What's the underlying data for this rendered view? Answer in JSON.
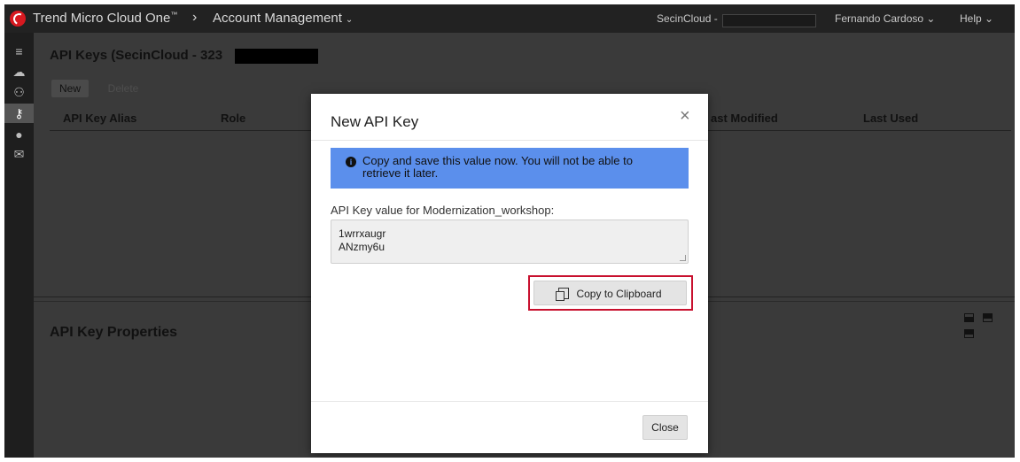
{
  "topbar": {
    "brand": "Trend Micro Cloud One",
    "brand_tm": "™",
    "separator": "›",
    "section": "Account Management",
    "section_chevron": "⌄",
    "account": "SecinCloud -",
    "user": "Fernando Cardoso",
    "user_chevron": "⌄",
    "help": "Help",
    "help_chevron": "⌄"
  },
  "sidebar": {
    "icons": [
      "menu-icon",
      "cloud-icon",
      "users-icon",
      "key-icon",
      "user-icon",
      "mail-icon"
    ],
    "active": "key-icon"
  },
  "main": {
    "title": "API Keys (SecinCloud - 323",
    "new_label": "New",
    "delete_label": "Delete",
    "columns": [
      "API Key Alias",
      "Role",
      "ast Modified",
      "Last Used"
    ],
    "properties_title": "API Key Properties"
  },
  "modal": {
    "title": "New API Key",
    "close_icon": "×",
    "alert_text": "Copy and save this value now. You will not be able to retrieve it later.",
    "field_label": "API Key value for Modernization_workshop:",
    "key_line1": "1wrrxaugr",
    "key_line2": "ANzmy6u",
    "copy_label": "Copy to Clipboard",
    "close_label": "Close"
  },
  "colors": {
    "alert_bg": "#5b8fec",
    "highlight": "#c8102e",
    "brand_red": "#d71920"
  }
}
